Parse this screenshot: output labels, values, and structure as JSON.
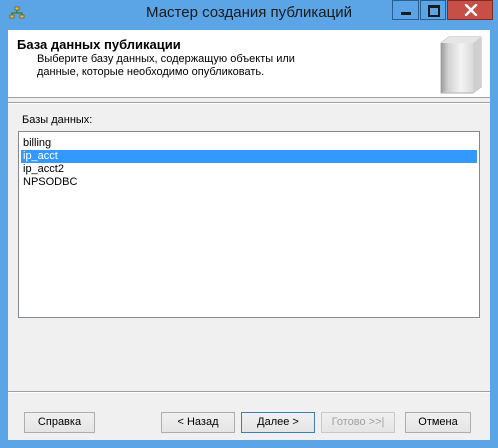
{
  "window": {
    "title": "Мастер создания публикаций"
  },
  "header": {
    "title": "База данных публикации",
    "description": "Выберите базу данных, содержащую объекты или данные, которые необходимо опубликовать."
  },
  "databases": {
    "label": "Базы данных:",
    "items": [
      {
        "name": "billing",
        "selected": false
      },
      {
        "name": "ip_acct",
        "selected": true
      },
      {
        "name": "ip_acct2",
        "selected": false
      },
      {
        "name": "NPSODBC",
        "selected": false
      }
    ]
  },
  "buttons": {
    "help": "Справка",
    "back": "< Назад",
    "next": "Далее >",
    "finish": "Готово >>|",
    "cancel": "Отмена"
  },
  "colors": {
    "titlebar": "#5ba4e6",
    "close_button": "#c74f45",
    "selection": "#3399ff"
  },
  "icons": [
    "wizard-app-icon",
    "minimize-icon",
    "maximize-icon",
    "close-icon",
    "publication-book-icon"
  ]
}
